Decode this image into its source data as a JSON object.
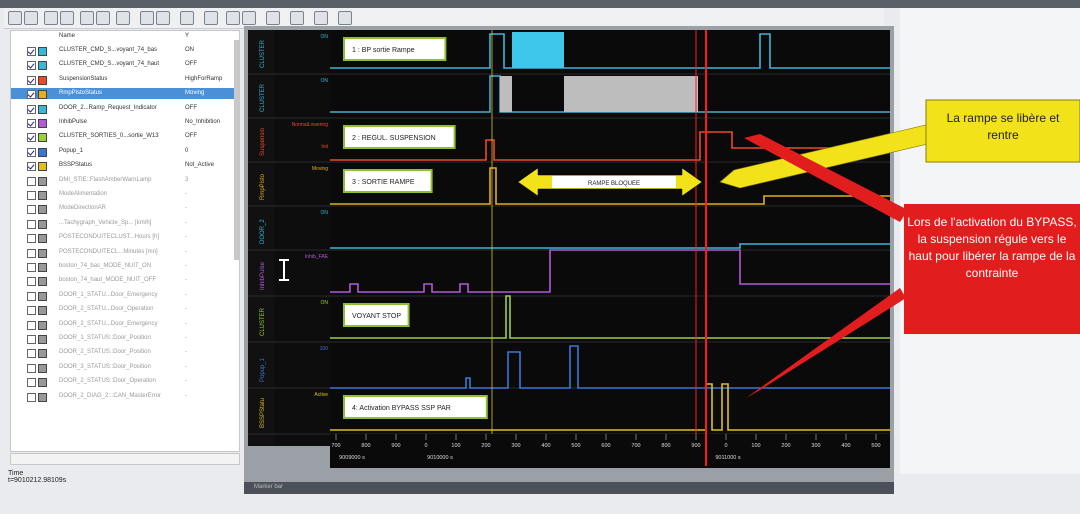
{
  "signals_header": {
    "name": "Name",
    "value": "Y"
  },
  "signals": [
    {
      "name": "CLUSTER_CMD_S...voyant_74_bas",
      "value": "ON",
      "checked": true,
      "color": "#39b7d8",
      "state": "normal"
    },
    {
      "name": "CLUSTER_CMD_S...voyant_74_haut",
      "value": "OFF",
      "checked": true,
      "color": "#39b7d8",
      "state": "normal"
    },
    {
      "name": "SuspensionStatus",
      "value": "HighForRamp",
      "checked": true,
      "color": "#e84b2a",
      "state": "normal"
    },
    {
      "name": "RmpPistoStatus",
      "value": "Moving",
      "checked": true,
      "color": "#e0b020",
      "state": "selected"
    },
    {
      "name": "DOOR_2...Ramp_Request_Indicator",
      "value": "OFF",
      "checked": true,
      "color": "#39b7d8",
      "state": "normal"
    },
    {
      "name": "InhibPulse",
      "value": "No_Inhibition",
      "checked": true,
      "color": "#b05ad8",
      "state": "normal"
    },
    {
      "name": "CLUSTER_SORTIES_0...sortie_W13",
      "value": "OFF",
      "checked": true,
      "color": "#9bd03a",
      "state": "normal"
    },
    {
      "name": "Popup_1",
      "value": "0",
      "checked": true,
      "color": "#3a76d8",
      "state": "normal"
    },
    {
      "name": "BSSPStatus",
      "value": "Not_Active",
      "checked": true,
      "color": "#e0c020",
      "state": "normal"
    },
    {
      "name": "DMI_STIE::FlashAmberWarnLamp",
      "value": "3",
      "checked": false,
      "color": "#999999",
      "state": "dim"
    },
    {
      "name": "ModeAlimentation",
      "value": "-",
      "checked": false,
      "color": "#999999",
      "state": "dim"
    },
    {
      "name": "ModeDirectionAR",
      "value": "-",
      "checked": false,
      "color": "#999999",
      "state": "dim"
    },
    {
      "name": "...Tachygraph_Vehicle_Sp... [km/h]",
      "value": "-",
      "checked": false,
      "color": "#999999",
      "state": "dim"
    },
    {
      "name": "POSTECONDUITECLUST...Hours [h]",
      "value": "-",
      "checked": false,
      "color": "#999999",
      "state": "dim"
    },
    {
      "name": "POSTECONDUITECL...Minutes [mn]",
      "value": "-",
      "checked": false,
      "color": "#999999",
      "state": "dim"
    },
    {
      "name": "boston_74_bas_MODE_NUIT_ON",
      "value": "-",
      "checked": false,
      "color": "#999999",
      "state": "dim"
    },
    {
      "name": "boston_74_haut_MODE_NUIT_OFF",
      "value": "-",
      "checked": false,
      "color": "#999999",
      "state": "dim"
    },
    {
      "name": "DOOR_1_STATU...Door_Emergency",
      "value": "-",
      "checked": false,
      "color": "#999999",
      "state": "dim"
    },
    {
      "name": "DOOR_2_STATU...Door_Operation",
      "value": "-",
      "checked": false,
      "color": "#999999",
      "state": "dim"
    },
    {
      "name": "DOOR_2_STATU...Door_Emergency",
      "value": "-",
      "checked": false,
      "color": "#999999",
      "state": "dim"
    },
    {
      "name": "DOOR_1_STATUS::Door_Position",
      "value": "-",
      "checked": false,
      "color": "#999999",
      "state": "dim"
    },
    {
      "name": "DOOR_2_STATUS::Door_Position",
      "value": "-",
      "checked": false,
      "color": "#999999",
      "state": "dim"
    },
    {
      "name": "DOOR_3_STATUS::Door_Position",
      "value": "-",
      "checked": false,
      "color": "#999999",
      "state": "dim"
    },
    {
      "name": "DOOR_2_STATUS::Door_Operation",
      "value": "-",
      "checked": false,
      "color": "#999999",
      "state": "dim"
    },
    {
      "name": "DOOR_2_DIAG_2:::CAN_MasterError",
      "value": "-",
      "checked": false,
      "color": "#999999",
      "state": "dim"
    }
  ],
  "status": {
    "label": "Time",
    "value": "t=9010212.98109s"
  },
  "footer": {
    "text": "Marker bar"
  },
  "axis": {
    "ticks": [
      "700",
      "800",
      "900",
      "0",
      "100",
      "200",
      "300",
      "400",
      "500",
      "600",
      "700",
      "800",
      "900",
      "0",
      "100",
      "200",
      "300",
      "400",
      "500"
    ],
    "secondary": [
      "9009000 s",
      "9010000 s",
      "9011000 s"
    ]
  },
  "lanes": [
    {
      "tag": "CLUSTER",
      "level_top": "ON",
      "level_bottom": "",
      "annotation": "1 : BP sortie Rampe"
    },
    {
      "tag": "CLUSTER",
      "level_top": "ON",
      "level_bottom": "",
      "annotation": ""
    },
    {
      "tag": "Suspensio",
      "level_top": "NormalLowering",
      "level_bottom": "Init",
      "annotation": "2 : REGUL. SUSPENSION"
    },
    {
      "tag": "RmpPisto",
      "level_top": "Moving",
      "level_bottom": "",
      "annotation": "3 : SORTIE RAMPE"
    },
    {
      "tag": "DOOR_2",
      "level_top": "ON",
      "level_bottom": "",
      "annotation": ""
    },
    {
      "tag": "InhibPulse",
      "level_top": "Inhib_FAE",
      "level_bottom": "",
      "annotation": ""
    },
    {
      "tag": "CLUSTER",
      "level_top": "ON",
      "level_bottom": "",
      "annotation": "VOYANT STOP"
    },
    {
      "tag": "Popup_1",
      "level_top": "100",
      "level_bottom": "",
      "annotation": ""
    },
    {
      "tag": "BSSPStatu",
      "level_top": "Active",
      "level_bottom": "",
      "annotation": "4: Activation BYPASS SSP PAR"
    }
  ],
  "ramp_label": "RAMPE BLOQUEE",
  "callouts": {
    "yellow": "La rampe se libère et rentre",
    "red": "Lors de l'activation du BYPASS, la suspension régule vers le haut pour libérer la rampe de la contrainte"
  },
  "colors": {
    "cursor": "#ff1a1a",
    "callout_yellow": "#f2e21a",
    "callout_red": "#e21d1d",
    "plot_bg": "#0a0a0a"
  }
}
